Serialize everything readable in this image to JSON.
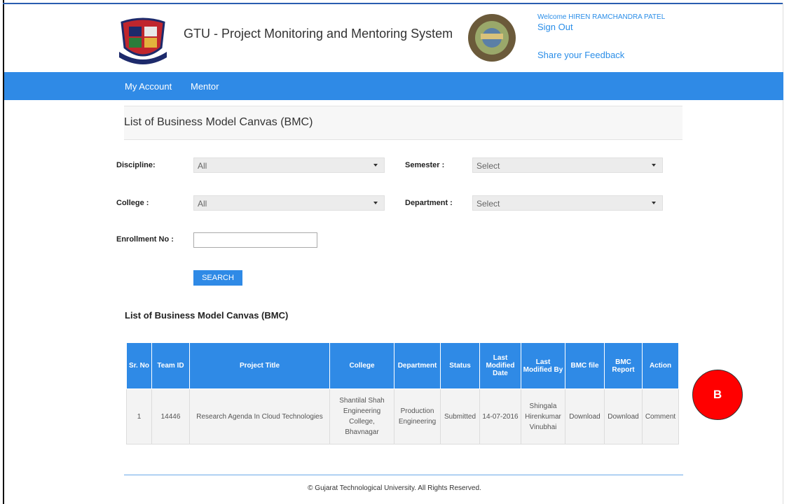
{
  "header": {
    "app_title": "GTU - Project Monitoring and Mentoring System",
    "welcome_text": "Welcome HIREN RAMCHANDRA PATEL",
    "sign_out": "Sign Out",
    "feedback": "Share your Feedback"
  },
  "nav": {
    "items": [
      {
        "label": "My Account"
      },
      {
        "label": "Mentor"
      }
    ]
  },
  "page": {
    "title": "List of Business Model Canvas (BMC)"
  },
  "filters": {
    "discipline_label": "Discipline:",
    "discipline_value": "All",
    "semester_label": "Semester :",
    "semester_value": "Select",
    "college_label": "College :",
    "college_value": "All",
    "department_label": "Department :",
    "department_value": "Select",
    "enrollment_label": "Enrollment No :",
    "enrollment_value": "",
    "search_button": "SEARCH"
  },
  "list": {
    "heading": "List of Business Model Canvas (BMC)",
    "columns": [
      "Sr. No",
      "Team ID",
      "Project Title",
      "College",
      "Department",
      "Status",
      "Last Modified Date",
      "Last Modified By",
      "BMC file",
      "BMC Report",
      "Action"
    ],
    "rows": [
      {
        "sr_no": "1",
        "team_id": "14446",
        "project_title": "Research Agenda In Cloud Technologies",
        "college": "Shantilal Shah Engineering College, Bhavnagar",
        "department": "Production Engineering",
        "status": "Submitted",
        "last_modified_date": "14-07-2016",
        "last_modified_by": "Shingala Hirenkumar Vinubhai",
        "bmc_file": "Download",
        "bmc_report": "Download",
        "action": "Comment"
      }
    ]
  },
  "footer": {
    "copyright": "© Gujarat Technological University. All Rights Reserved."
  },
  "annotation": {
    "marker_label": "B",
    "marker_color": "#ff0000"
  },
  "colors": {
    "accent": "#2f8ae6",
    "link": "#2b8ee8",
    "status_submitted": "#e0261f"
  }
}
